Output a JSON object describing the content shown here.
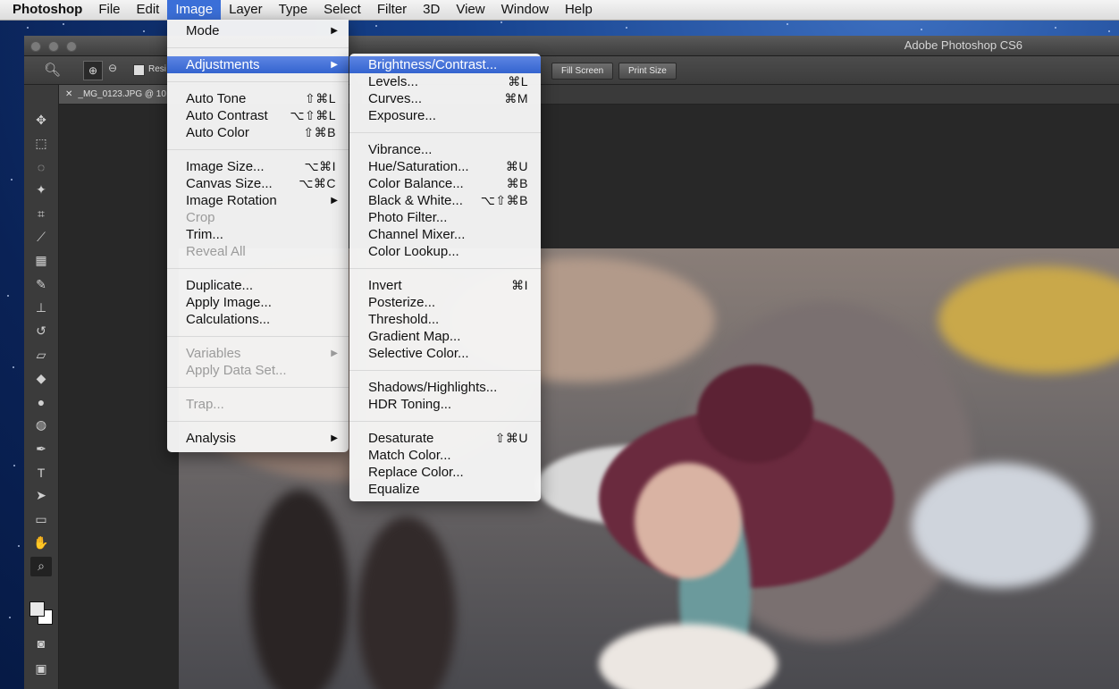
{
  "menubar": {
    "app": "Photoshop",
    "items": [
      "File",
      "Edit",
      "Image",
      "Layer",
      "Type",
      "Select",
      "Filter",
      "3D",
      "View",
      "Window",
      "Help"
    ]
  },
  "window": {
    "title": "Adobe Photoshop CS6",
    "tab": "_MG_0123.JPG @ 10",
    "options": {
      "resize_label": "Resi",
      "fill_screen": "Fill Screen",
      "print_size": "Print Size"
    }
  },
  "image_menu": {
    "items": [
      {
        "label": "Mode",
        "submenu": true
      },
      {
        "sep": true
      },
      {
        "label": "Adjustments",
        "submenu": true,
        "highlighted": true
      },
      {
        "sep": true
      },
      {
        "label": "Auto Tone",
        "shortcut": "⇧⌘L"
      },
      {
        "label": "Auto Contrast",
        "shortcut": "⌥⇧⌘L"
      },
      {
        "label": "Auto Color",
        "shortcut": "⇧⌘B"
      },
      {
        "sep": true
      },
      {
        "label": "Image Size...",
        "shortcut": "⌥⌘I"
      },
      {
        "label": "Canvas Size...",
        "shortcut": "⌥⌘C"
      },
      {
        "label": "Image Rotation",
        "submenu": true
      },
      {
        "label": "Crop",
        "disabled": true
      },
      {
        "label": "Trim..."
      },
      {
        "label": "Reveal All",
        "disabled": true
      },
      {
        "sep": true
      },
      {
        "label": "Duplicate..."
      },
      {
        "label": "Apply Image..."
      },
      {
        "label": "Calculations..."
      },
      {
        "sep": true
      },
      {
        "label": "Variables",
        "submenu": true,
        "disabled": true
      },
      {
        "label": "Apply Data Set...",
        "disabled": true
      },
      {
        "sep": true
      },
      {
        "label": "Trap...",
        "disabled": true
      },
      {
        "sep": true
      },
      {
        "label": "Analysis",
        "submenu": true
      }
    ]
  },
  "adjustments_menu": {
    "items": [
      {
        "label": "Brightness/Contrast...",
        "highlighted": true
      },
      {
        "label": "Levels...",
        "shortcut": "⌘L"
      },
      {
        "label": "Curves...",
        "shortcut": "⌘M"
      },
      {
        "label": "Exposure..."
      },
      {
        "sep": true
      },
      {
        "label": "Vibrance..."
      },
      {
        "label": "Hue/Saturation...",
        "shortcut": "⌘U"
      },
      {
        "label": "Color Balance...",
        "shortcut": "⌘B"
      },
      {
        "label": "Black & White...",
        "shortcut": "⌥⇧⌘B"
      },
      {
        "label": "Photo Filter..."
      },
      {
        "label": "Channel Mixer..."
      },
      {
        "label": "Color Lookup..."
      },
      {
        "sep": true
      },
      {
        "label": "Invert",
        "shortcut": "⌘I"
      },
      {
        "label": "Posterize..."
      },
      {
        "label": "Threshold..."
      },
      {
        "label": "Gradient Map..."
      },
      {
        "label": "Selective Color..."
      },
      {
        "sep": true
      },
      {
        "label": "Shadows/Highlights..."
      },
      {
        "label": "HDR Toning..."
      },
      {
        "sep": true
      },
      {
        "label": "Desaturate",
        "shortcut": "⇧⌘U"
      },
      {
        "label": "Match Color..."
      },
      {
        "label": "Replace Color..."
      },
      {
        "label": "Equalize"
      }
    ]
  },
  "tools": [
    "move-icon",
    "marquee-icon",
    "lasso-icon",
    "magic-wand-icon",
    "crop-icon",
    "eyedropper-icon",
    "healing-icon",
    "brush-icon",
    "stamp-icon",
    "history-brush-icon",
    "eraser-icon",
    "paint-bucket-icon",
    "blur-icon",
    "dodge-icon",
    "pen-icon",
    "type-icon",
    "path-select-icon",
    "rectangle-icon",
    "hand-icon",
    "zoom-icon"
  ]
}
